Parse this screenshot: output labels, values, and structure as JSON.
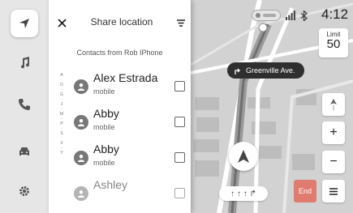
{
  "panel": {
    "title": "Share location",
    "subtitle": "Contacts from Rob IPhone",
    "index_letters": [
      "A",
      "·",
      "D",
      "·",
      "G",
      "·",
      "J",
      "·",
      "M",
      "·",
      "P",
      "·",
      "S",
      "·",
      "V",
      "·",
      "Y"
    ],
    "contacts": [
      {
        "name": "Alex Estrada",
        "sub": "mobile"
      },
      {
        "name": "Abby",
        "sub": "mobile"
      },
      {
        "name": "Abby",
        "sub": "mobile"
      },
      {
        "name": "Ashley",
        "sub": ""
      }
    ]
  },
  "status": {
    "clock": "4:12"
  },
  "map": {
    "speed_limit_label": "Limit",
    "speed_limit_value": "50",
    "next_street": "Greenville Ave.",
    "end_label": "End",
    "zoom_in": "+",
    "zoom_out": "−",
    "lane_arrows": "↑ ↑ ↑ ↱"
  },
  "colors": {
    "end_button": "#e07b6f",
    "nav_chip": "#2f2f2f"
  }
}
